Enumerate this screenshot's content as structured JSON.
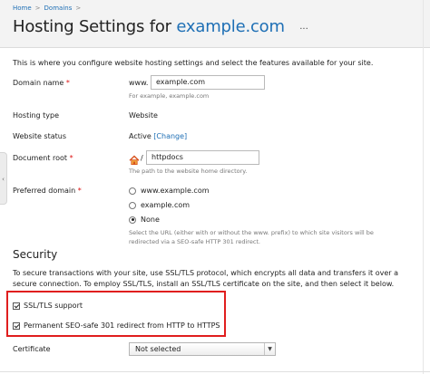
{
  "breadcrumb": {
    "items": [
      "Home",
      "Domains"
    ],
    "separator": ">"
  },
  "page": {
    "title_prefix": "Hosting Settings for",
    "title_domain": "example.com",
    "more_button": "..."
  },
  "intro": "This is where you configure website hosting settings and select the features available for your site.",
  "form": {
    "domain_name": {
      "label": "Domain name",
      "required_mark": "*",
      "prefix": "www.",
      "value": "example.com",
      "hint": "For example, example.com"
    },
    "hosting_type": {
      "label": "Hosting type",
      "value": "Website"
    },
    "website_status": {
      "label": "Website status",
      "value": "Active",
      "change_link": "[Change]"
    },
    "document_root": {
      "label": "Document root",
      "required_mark": "*",
      "home_icon": "home-icon",
      "slash": "/",
      "value": "httpdocs",
      "hint": "The path to the website home directory."
    },
    "preferred_domain": {
      "label": "Preferred domain",
      "required_mark": "*",
      "options": [
        {
          "label": "www.example.com",
          "selected": false
        },
        {
          "label": "example.com",
          "selected": false
        },
        {
          "label": "None",
          "selected": true
        }
      ],
      "hint_line1": "Select the URL (either with or without the www. prefix) to which site visitors will be",
      "hint_line2": "redirected via a SEO-safe HTTP 301 redirect."
    }
  },
  "security": {
    "title": "Security",
    "description": "To secure transactions with your site, use SSL/TLS protocol, which encrypts all data and transfers it over a secure connection. To employ SSL/TLS, install an SSL/TLS certificate on the site, and then select it below.",
    "ssl_support": {
      "label": "SSL/TLS support",
      "checked": true
    },
    "redirect": {
      "label": "Permanent SEO-safe 301 redirect from HTTP to HTTPS",
      "checked": true
    },
    "certificate": {
      "label": "Certificate",
      "value": "Not selected"
    },
    "highlight_color": "#e01e1e"
  },
  "colors": {
    "link": "#1e6fb5",
    "required": "#dd1111",
    "header_bg": "#f3f3f3"
  }
}
